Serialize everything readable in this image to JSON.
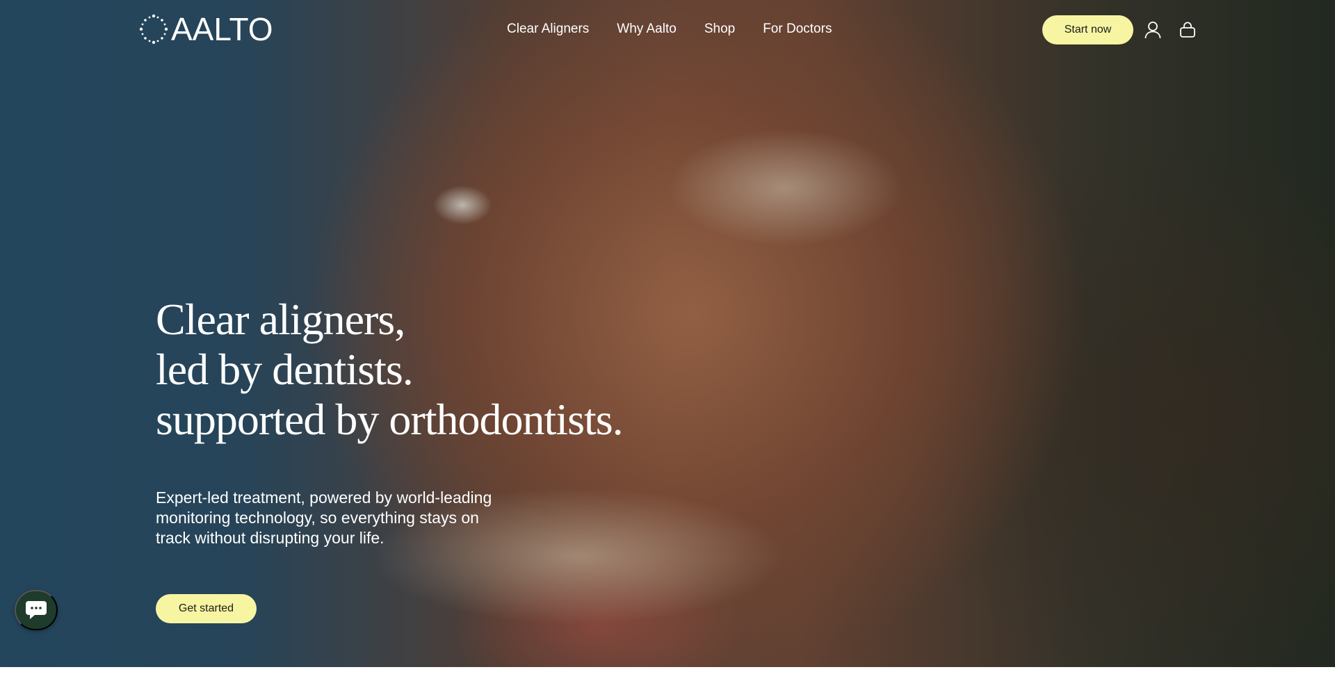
{
  "brand": {
    "name": "AALTO"
  },
  "nav": {
    "links": [
      "Clear Aligners",
      "Why Aalto",
      "Shop",
      "For Doctors"
    ],
    "start_label": "Start now",
    "account_icon": "user-icon",
    "cart_icon": "bag-icon"
  },
  "hero": {
    "headline": [
      "Clear aligners,",
      "led by dentists.",
      "supported by orthodontists."
    ],
    "subtext": [
      "Expert-led treatment, powered by world-leading",
      "monitoring technology, so everything stays on",
      "track without disrupting your life."
    ],
    "cta_label": "Get started"
  },
  "chat": {
    "icon": "chat-bubble-icon"
  },
  "colors": {
    "accent": "#f7f5a2",
    "chat_bg": "#1e3b2b",
    "text": "#ffffff"
  }
}
